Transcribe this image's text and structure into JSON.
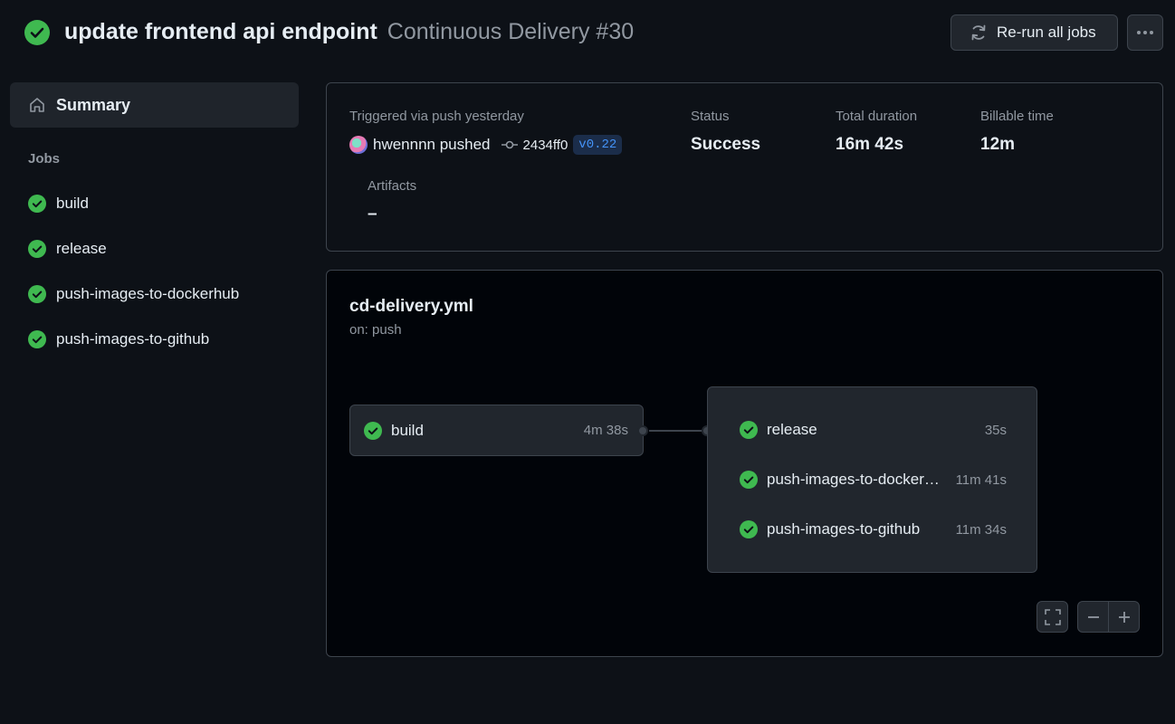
{
  "header": {
    "title": "update frontend api endpoint",
    "workflow_run": "Continuous Delivery #30",
    "rerun_label": "Re-run all jobs",
    "status_icon": "check-circle-icon"
  },
  "sidebar": {
    "summary_label": "Summary",
    "jobs_heading": "Jobs",
    "jobs": [
      {
        "label": "build",
        "status": "success"
      },
      {
        "label": "release",
        "status": "success"
      },
      {
        "label": "push-images-to-dockerhub",
        "status": "success"
      },
      {
        "label": "push-images-to-github",
        "status": "success"
      }
    ]
  },
  "summary": {
    "trigger_label": "Triggered via push yesterday",
    "actor_text": "hwennnn pushed",
    "commit_sha": "2434ff0",
    "tag": "v0.22",
    "status_label": "Status",
    "status_value": "Success",
    "duration_label": "Total duration",
    "duration_value": "16m 42s",
    "billable_label": "Billable time",
    "billable_value": "12m",
    "artifacts_label": "Artifacts",
    "artifacts_value": "–"
  },
  "graph": {
    "workflow_file": "cd-delivery.yml",
    "trigger": "on: push",
    "build": {
      "label": "build",
      "duration": "4m 38s"
    },
    "group": [
      {
        "label": "release",
        "duration": "35s"
      },
      {
        "label": "push-images-to-dockerhub",
        "duration": "11m 41s"
      },
      {
        "label": "push-images-to-github",
        "duration": "11m 34s"
      }
    ]
  },
  "colors": {
    "success": "#3fb950",
    "background": "#0d1117",
    "link": "#4493f8"
  }
}
